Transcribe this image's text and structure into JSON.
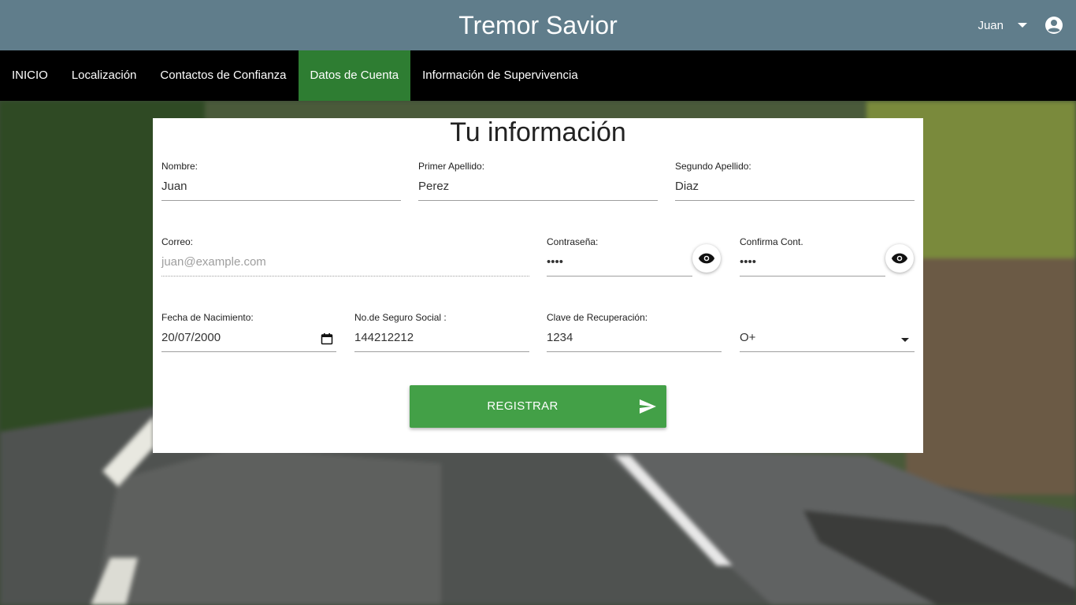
{
  "header": {
    "title": "Tremor Savior",
    "user_name": "Juan"
  },
  "nav": {
    "items": [
      {
        "label": "INICIO"
      },
      {
        "label": "Localización"
      },
      {
        "label": "Contactos de Confianza"
      },
      {
        "label": "Datos de Cuenta",
        "active": true
      },
      {
        "label": "Información de Supervivencia"
      }
    ]
  },
  "form": {
    "title": "Tu información",
    "nombre": {
      "label": "Nombre:",
      "value": "Juan"
    },
    "primer_apellido": {
      "label": "Primer Apellido:",
      "value": "Perez"
    },
    "segundo_apellido": {
      "label": "Segundo Apellido:",
      "value": "Diaz"
    },
    "correo": {
      "label": "Correo:",
      "placeholder": "juan@example.com"
    },
    "contrasena": {
      "label": "Contraseña:",
      "value": "••••"
    },
    "confirma": {
      "label": "Confirma Cont.",
      "value": "••••"
    },
    "fecha": {
      "label": "Fecha de Nacimiento:",
      "value": "20/07/2000"
    },
    "seguro": {
      "label": "No.de Seguro Social :",
      "value": "144212212"
    },
    "clave": {
      "label": "Clave de Recuperación:",
      "value": "1234"
    },
    "sangre": {
      "value": "O+"
    },
    "submit_label": "REGISTRAR"
  },
  "colors": {
    "header_bg": "#607d8b",
    "nav_bg": "#000000",
    "nav_active": "#2e7d32",
    "button": "#43a047"
  },
  "icons": [
    "account-circle-icon",
    "chevron-down-icon",
    "eye-icon",
    "calendar-icon",
    "send-icon"
  ]
}
